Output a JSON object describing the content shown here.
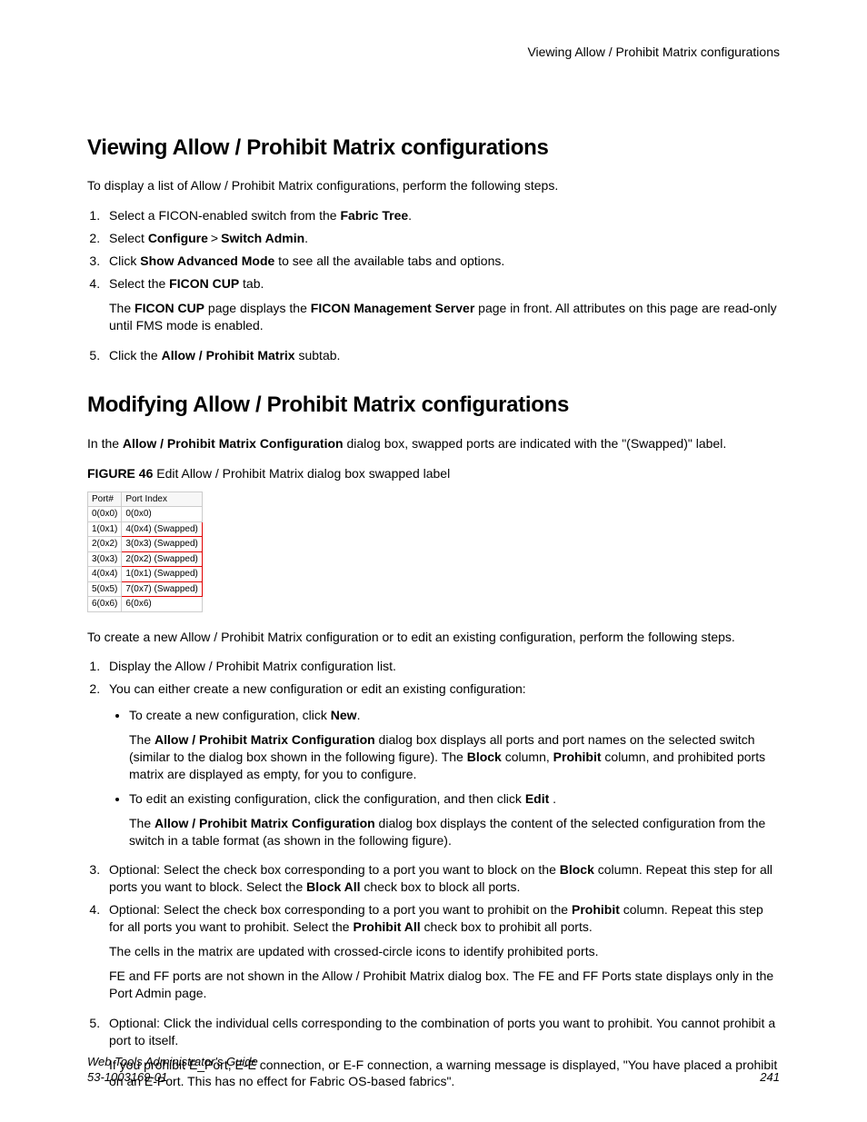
{
  "running_header": "Viewing Allow / Prohibit Matrix configurations",
  "section1": {
    "heading": "Viewing Allow / Prohibit Matrix configurations",
    "intro": "To display a list of Allow / Prohibit Matrix configurations, perform the following steps.",
    "steps": {
      "s1_a": "Select a FICON-enabled switch from the ",
      "s1_b": "Fabric Tree",
      "s1_c": ".",
      "s2_a": "Select ",
      "s2_b": "Configure",
      "s2_gt": ">",
      "s2_c": "Switch Admin",
      "s2_d": ".",
      "s3_a": "Click ",
      "s3_b": "Show Advanced Mode",
      "s3_c": " to see all the available tabs and options.",
      "s4_a": "Select the ",
      "s4_b": "FICON CUP",
      "s4_c": " tab.",
      "s4_p_a": "The ",
      "s4_p_b": "FICON CUP",
      "s4_p_c": " page displays the ",
      "s4_p_d": "FICON Management Server",
      "s4_p_e": " page in front. All attributes on this page are read-only until FMS mode is enabled.",
      "s5_a": "Click the ",
      "s5_b": "Allow / Prohibit Matrix",
      "s5_c": " subtab."
    }
  },
  "section2": {
    "heading": "Modifying Allow / Prohibit Matrix configurations",
    "intro_a": "In the ",
    "intro_b": "Allow / Prohibit Matrix Configuration",
    "intro_c": " dialog box, swapped ports are indicated with the \"(Swapped)\" label.",
    "figure": {
      "label": "FIGURE 46",
      "caption": " Edit Allow / Prohibit Matrix dialog box swapped label"
    },
    "swap_table": {
      "h1": "Port#",
      "h2": "Port Index",
      "rows": [
        {
          "p": "0(0x0)",
          "i": "0(0x0)",
          "s": false
        },
        {
          "p": "1(0x1)",
          "i": "4(0x4) (Swapped)",
          "s": true
        },
        {
          "p": "2(0x2)",
          "i": "3(0x3) (Swapped)",
          "s": true
        },
        {
          "p": "3(0x3)",
          "i": "2(0x2) (Swapped)",
          "s": true
        },
        {
          "p": "4(0x4)",
          "i": "1(0x1) (Swapped)",
          "s": true
        },
        {
          "p": "5(0x5)",
          "i": "7(0x7) (Swapped)",
          "s": true
        },
        {
          "p": "6(0x6)",
          "i": "6(0x6)",
          "s": false
        }
      ]
    },
    "intro2": "To create a new Allow / Prohibit Matrix configuration or to edit an existing configuration, perform the following steps.",
    "steps": {
      "s1": "Display the Allow / Prohibit Matrix configuration list.",
      "s2": "You can either create a new configuration or edit an existing configuration:",
      "s2_b1_a": "To create a new configuration, click ",
      "s2_b1_b": "New",
      "s2_b1_c": ".",
      "s2_b1_p_a": "The ",
      "s2_b1_p_b": "Allow / Prohibit Matrix Configuration",
      "s2_b1_p_c": " dialog box displays all ports and port names on the selected switch (similar to the dialog box shown in the following figure). The ",
      "s2_b1_p_d": "Block",
      "s2_b1_p_e": " column, ",
      "s2_b1_p_f": "Prohibit",
      "s2_b1_p_g": " column, and prohibited ports matrix are displayed as empty, for you to configure.",
      "s2_b2_a": "To edit an existing configuration, click the configuration, and then click ",
      "s2_b2_b": "Edit",
      "s2_b2_c": " .",
      "s2_b2_p_a": "The ",
      "s2_b2_p_b": "Allow / Prohibit Matrix Configuration",
      "s2_b2_p_c": " dialog box displays the content of the selected configuration from the switch in a table format (as shown in the following figure).",
      "s3_a": "Optional: Select the check box corresponding to a port you want to block on the ",
      "s3_b": "Block",
      "s3_c": " column. Repeat this step for all ports you want to block. Select the ",
      "s3_d": "Block All",
      "s3_e": " check box to block all ports.",
      "s4_a": "Optional: Select the check box corresponding to a port you want to prohibit on the ",
      "s4_b": "Prohibit",
      "s4_c": " column. Repeat this step for all ports you want to prohibit. Select the ",
      "s4_d": "Prohibit All",
      "s4_e": " check box to prohibit all ports.",
      "s4_p1": "The cells in the matrix are updated with crossed-circle icons to identify prohibited ports.",
      "s4_p2": "FE and FF ports are not shown in the Allow / Prohibit Matrix dialog box. The FE and FF Ports state displays only in the Port Admin page.",
      "s5": "Optional: Click the individual cells corresponding to the combination of ports you want to prohibit. You cannot prohibit a port to itself.",
      "s5_p": "If you prohibit E_Port, E-E connection, or E-F connection, a warning message is displayed, \"You have placed a prohibit on an E-Port. This has no effect for Fabric OS-based fabrics\"."
    }
  },
  "footer": {
    "title": "Web Tools Administrator's Guide",
    "docnum": "53-1003169-01",
    "page": "241"
  }
}
